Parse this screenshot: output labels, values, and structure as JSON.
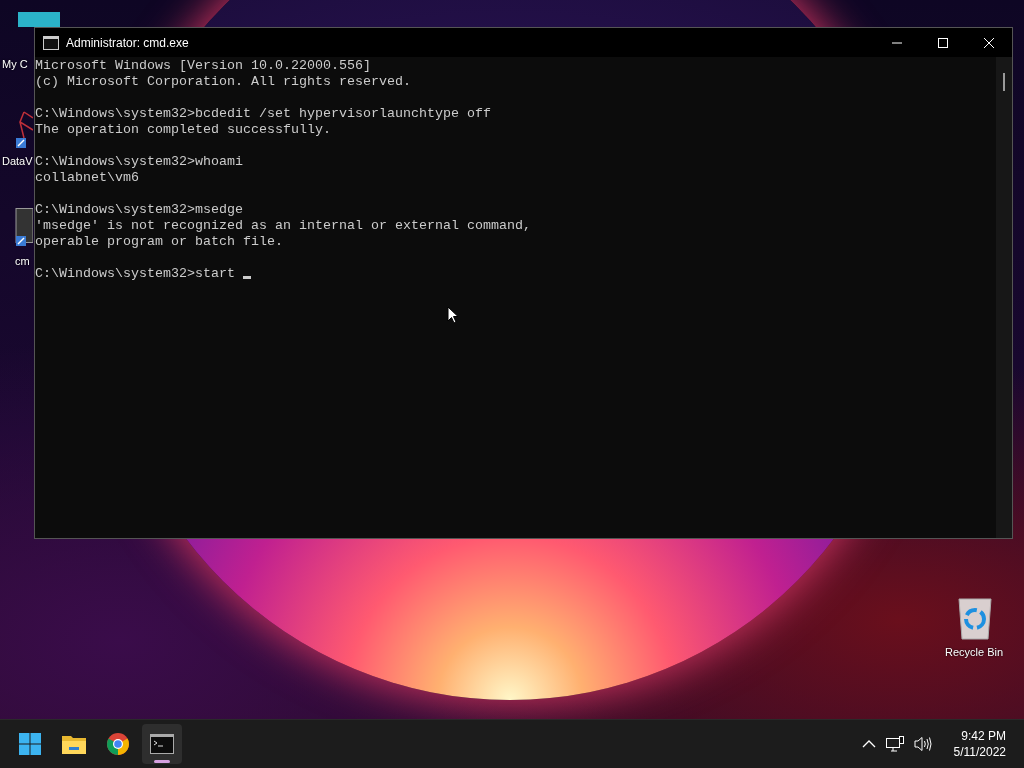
{
  "desktop_icons": [
    {
      "kind": "monitor",
      "label": "My C"
    },
    {
      "kind": "molecule",
      "label": "DataV"
    },
    {
      "kind": "console",
      "label": "cm"
    },
    {
      "kind": "recycle",
      "label": "Recycle Bin"
    }
  ],
  "window": {
    "title": "Administrator: cmd.exe",
    "blocks": [
      [
        "Microsoft Windows [Version 10.0.22000.556]",
        "(c) Microsoft Corporation. All rights reserved."
      ],
      [
        "C:\\Windows\\system32>bcdedit /set hypervisorlaunchtype off",
        "The operation completed successfully."
      ],
      [
        "C:\\Windows\\system32>whoami",
        "collabnet\\vm6"
      ],
      [
        "C:\\Windows\\system32>msedge",
        "'msedge' is not recognized as an internal or external command,",
        "operable program or batch file."
      ],
      [
        "C:\\Windows\\system32>start "
      ]
    ]
  },
  "taskbar": {
    "apps": [
      {
        "kind": "start",
        "active": false
      },
      {
        "kind": "folder",
        "active": false
      },
      {
        "kind": "chrome",
        "active": false
      },
      {
        "kind": "console",
        "active": true
      }
    ],
    "time": "9:42 PM",
    "date": "5/11/2022"
  }
}
